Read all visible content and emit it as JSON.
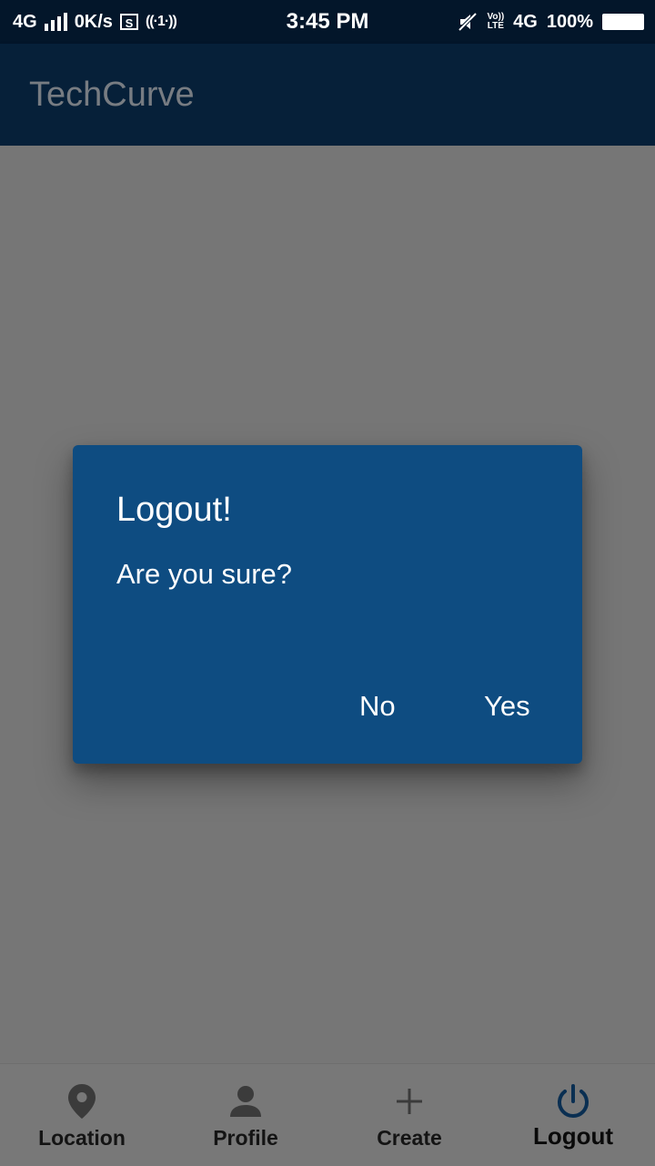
{
  "status_bar": {
    "network_left": "4G",
    "speed": "0K/s",
    "sd_label": "S",
    "hotspot_label": "((·1·))",
    "time": "3:45 PM",
    "volte_top": "Vo))",
    "volte_bottom": "LTE",
    "network_right": "4G",
    "battery": "100%"
  },
  "app_bar": {
    "title": "TechCurve"
  },
  "dialog": {
    "title": "Logout!",
    "message": "Are you sure?",
    "no_label": "No",
    "yes_label": "Yes"
  },
  "bottom_nav": {
    "items": [
      {
        "label": "Location",
        "icon": "location-pin-icon"
      },
      {
        "label": "Profile",
        "icon": "person-icon"
      },
      {
        "label": "Create",
        "icon": "plus-icon"
      },
      {
        "label": "Logout",
        "icon": "power-icon"
      }
    ],
    "active": "Logout"
  },
  "colors": {
    "scrim": "#767676",
    "app_bar": "#062039",
    "dialog": "#0e4c81",
    "active_icon": "#0a2f52"
  }
}
